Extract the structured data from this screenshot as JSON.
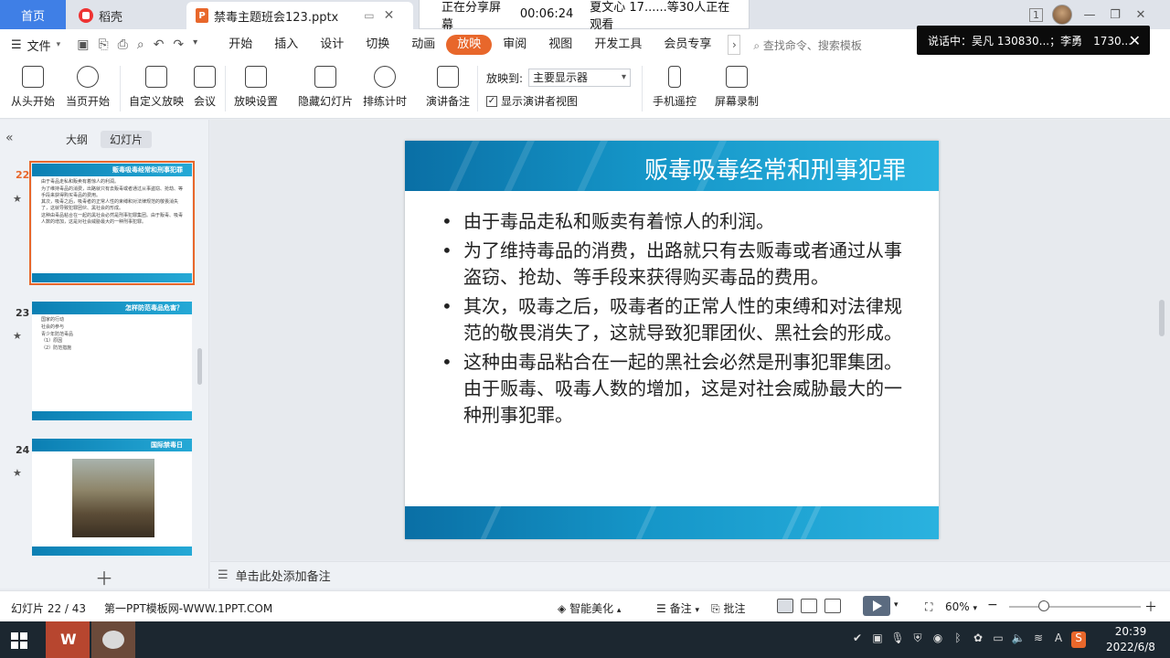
{
  "tabs": {
    "home": "首页",
    "docer": "稻壳",
    "document": "禁毒主题班会123.pptx"
  },
  "share_banner": {
    "status": "正在分享屏幕",
    "timer": "00:06:24",
    "viewers": "夏文心 17......等30人正在观看"
  },
  "top_right": {
    "badge": "1"
  },
  "menu": {
    "file": "文件",
    "tabs": [
      "开始",
      "插入",
      "设计",
      "切换",
      "动画",
      "放映",
      "审阅",
      "视图",
      "开发工具",
      "会员专享"
    ],
    "active_tab": "放映",
    "search_placeholder": "查找命令、搜索模板"
  },
  "speaking": {
    "text": "说话中：吴凡 130830...；李勇　1730..."
  },
  "ribbon": {
    "from_start": "从头开始",
    "from_current": "当页开始",
    "custom_show": "自定义放映",
    "meeting": "会议",
    "show_settings": "放映设置",
    "hide_slide": "隐藏幻灯片",
    "rehearse": "排练计时",
    "speaker_notes": "演讲备注",
    "show_to_label": "放映到:",
    "show_to_value": "主要显示器",
    "presenter_view_label": "显示演讲者视图",
    "phone_remote": "手机遥控",
    "screen_record": "屏幕录制"
  },
  "left_panel": {
    "tab_outline": "大纲",
    "tab_slides": "幻灯片",
    "thumbnails": [
      {
        "number": "22",
        "title": "贩毒吸毒经常和刑事犯罪",
        "lines": [
          "由于毒品走私和贩卖有着惊人的利润。",
          "为了维持毒品的消费，出路就只有去贩毒或者通过从事盗窃、抢劫、等手段来获得购买毒品的费用。",
          "其次，吸毒之后，吸毒者的正常人性的束缚和对法律规范的敬畏消失了，这就导致犯罪团伙、黑社会的形成。",
          "这种由毒品粘合在一起的黑社会必然是刑事犯罪集团。由于贩毒、吸毒人数的增加，这是对社会威胁最大的一种刑事犯罪。"
        ]
      },
      {
        "number": "23",
        "title": "怎样防范毒品危害？",
        "lines": [
          "国家的行动",
          "社会的参与",
          "青少年防范毒品",
          "（1）原因",
          "（2）防范措施"
        ]
      },
      {
        "number": "24",
        "title": "国际禁毒日",
        "lines": []
      }
    ]
  },
  "slide": {
    "title": "贩毒吸毒经常和刑事犯罪",
    "bullets": [
      "由于毒品走私和贩卖有着惊人的利润。",
      "为了维持毒品的消费，出路就只有去贩毒或者通过从事盗窃、抢劫、等手段来获得购买毒品的费用。",
      "其次，吸毒之后，吸毒者的正常人性的束缚和对法律规范的敬畏消失了，这就导致犯罪团伙、黑社会的形成。",
      "这种由毒品粘合在一起的黑社会必然是刑事犯罪集团。由于贩毒、吸毒人数的增加，这是对社会威胁最大的一种刑事犯罪。"
    ]
  },
  "notes": {
    "placeholder": "单击此处添加备注"
  },
  "status": {
    "slide_count": "幻灯片 22 / 43",
    "template": "第一PPT模板网-WWW.1PPT.COM",
    "smart_beautify": "智能美化",
    "notes": "备注",
    "comments": "批注",
    "zoom": "60%",
    "zoom_fraction": 0.6
  },
  "taskbar": {
    "time": "20:39",
    "date": "2022/6/8"
  },
  "colors": {
    "accent": "#e8672b",
    "home_tab": "#3f7fe6",
    "slide_blue": "#1596c8"
  }
}
